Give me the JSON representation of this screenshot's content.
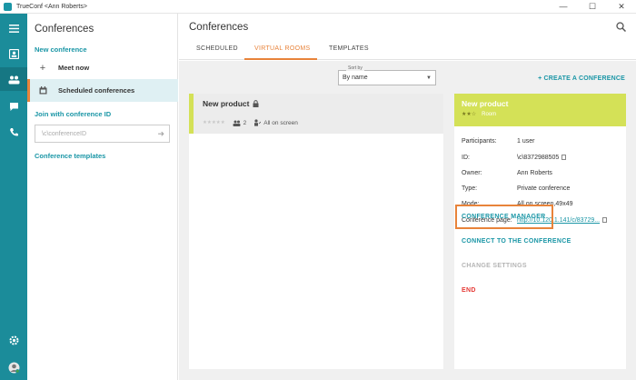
{
  "window": {
    "title": "TrueConf <Ann Roberts>",
    "buttons": [
      "—",
      "☐",
      "✕"
    ]
  },
  "rail": {
    "icons": [
      "menu-icon",
      "contacts-icon",
      "conferences-icon",
      "chat-icon",
      "call-history-icon",
      "settings-icon",
      "user-avatar"
    ]
  },
  "panel": {
    "title": "Conferences",
    "new_conference": "New conference",
    "meet_now": "Meet now",
    "scheduled": "Scheduled conferences",
    "join_label": "Join with conference ID",
    "join_placeholder": "\\c\\conferenceID",
    "templates": "Conference templates"
  },
  "main": {
    "title": "Conferences",
    "tabs": [
      "SCHEDULED",
      "VIRTUAL ROOMS",
      "TEMPLATES"
    ],
    "sort_label": "Sort by",
    "sort_value": "By name",
    "create": "+ CREATE A CONFERENCE"
  },
  "card": {
    "name": "New product",
    "rating": "★★★★★",
    "participants": "2",
    "mode": "All on screen"
  },
  "detail": {
    "title": "New product",
    "stars": "★★☆",
    "type_badge": "Room",
    "fields": {
      "participants_k": "Participants:",
      "participants_v": "1 user",
      "id_k": "ID:",
      "id_v": "\\c\\8372988505",
      "owner_k": "Owner:",
      "owner_v": "Ann Roberts",
      "type_k": "Type:",
      "type_v": "Private conference",
      "mode_k": "Mode:",
      "mode_v": "All on screen,49x49",
      "page_k": "Conference page:",
      "page_v": "http://10.120.1.141/c/83729..."
    },
    "actions": {
      "manager": "CONFERENCE MANAGER",
      "connect": "CONNECT TO THE CONFERENCE",
      "change": "CHANGE SETTINGS",
      "end": "END"
    }
  },
  "colors": {
    "teal": "#1b8c9a",
    "accent": "#e8833a",
    "lime": "#d4e157",
    "red": "#e53935"
  }
}
